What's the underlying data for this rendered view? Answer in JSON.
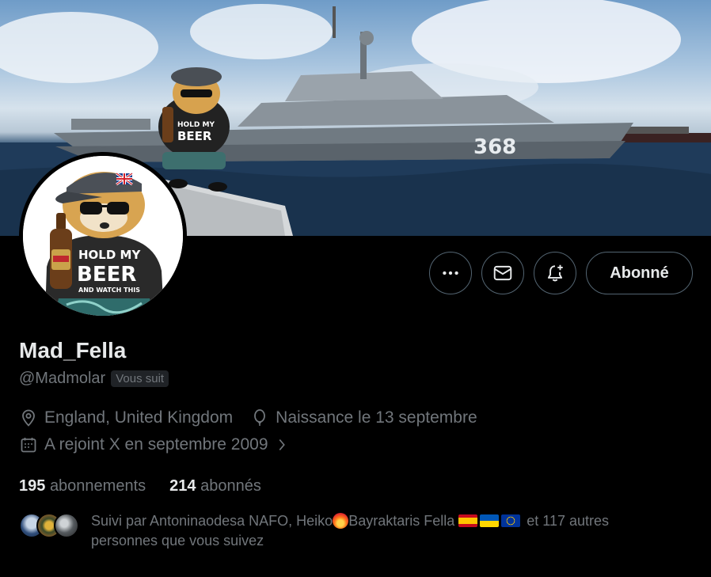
{
  "profile": {
    "name": "Mad_Fella",
    "handle": "@Madmolar",
    "follows_you_badge": "Vous suit",
    "location": "England, United Kingdom",
    "birthday": "Naissance le 13 septembre",
    "joined": "A rejoint X en septembre 2009"
  },
  "actions": {
    "more_icon": "more-horizontal-icon",
    "message_icon": "envelope-icon",
    "notify_icon": "bell-plus-icon",
    "follow_label": "Abonné"
  },
  "stats": {
    "following_count": "195",
    "following_label": "abonnements",
    "followers_count": "214",
    "followers_label": "abonnés"
  },
  "followed_by": {
    "prefix": "Suivi par ",
    "names_1": "Antoninaodesa NAFO, Heiko",
    "names_2": "Bayraktaris Fella",
    "suffix": " et 117 autres personnes que vous suivez"
  },
  "banner": {
    "hull_number": "368",
    "shirt_text_1": "HOLD MY",
    "shirt_text_2": "BEER",
    "shirt_text_3": "AND WATCH THIS"
  },
  "colors": {
    "background": "#000000",
    "text_primary": "#e7e9ea",
    "text_secondary": "#71767b",
    "border": "#536471"
  }
}
